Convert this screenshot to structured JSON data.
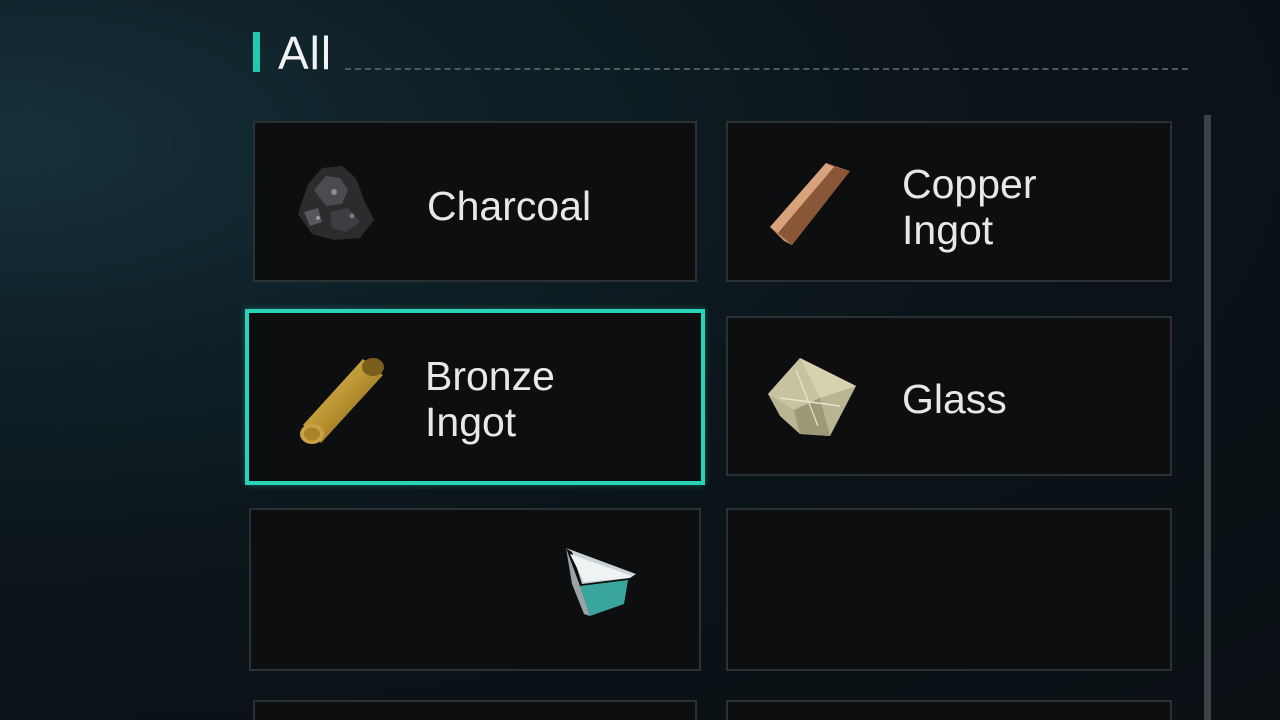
{
  "category": {
    "title": "All"
  },
  "items": [
    {
      "name": "Charcoal",
      "icon": "charcoal-icon",
      "selected": false
    },
    {
      "name": "Copper\nIngot",
      "icon": "copper-ingot-icon",
      "selected": false
    },
    {
      "name": "Bronze\nIngot",
      "icon": "bronze-ingot-icon",
      "selected": true
    },
    {
      "name": "Glass",
      "icon": "glass-icon",
      "selected": false
    }
  ],
  "colors": {
    "accent": "#22c9b0",
    "selection": "#2ad3b7",
    "tile_bg": "#0d0e0f",
    "tile_border": "#2b3033"
  }
}
